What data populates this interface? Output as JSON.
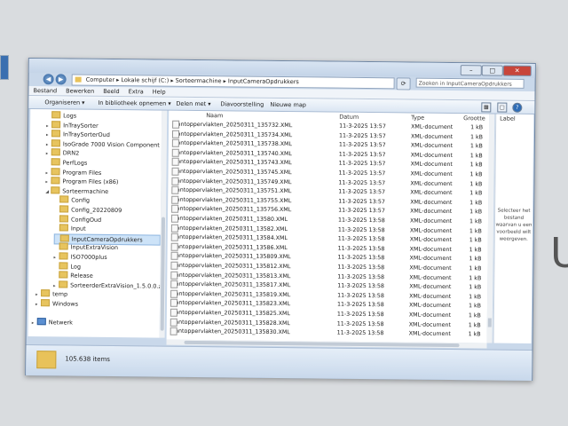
{
  "window": {
    "minimize": "–",
    "maximize": "□",
    "close": "✕"
  },
  "address": {
    "segments": [
      "Computer",
      "Lokale schijf (C:)",
      "Sorteermachine",
      "InputCameraOpdrukkers"
    ],
    "search_placeholder": "Zoeken in InputCameraOpdrukkers"
  },
  "menu": [
    "Bestand",
    "Bewerken",
    "Beeld",
    "Extra",
    "Help"
  ],
  "toolbar": {
    "organize": "Organiseren ▾",
    "library": "In bibliotheek opnemen ▾",
    "share": "Delen met ▾",
    "slideshow": "Diavoorstelling",
    "new_folder": "Nieuwe map"
  },
  "nav": [
    {
      "label": "Logs",
      "indent": 1,
      "arrow": ""
    },
    {
      "label": "InTraySorter",
      "indent": 1,
      "arrow": "▸"
    },
    {
      "label": "InTraySorterOud",
      "indent": 1,
      "arrow": "▸"
    },
    {
      "label": "IsoGrade 7000 Vision Component Initial",
      "indent": 1,
      "arrow": "▸"
    },
    {
      "label": "DRN2",
      "indent": 1,
      "arrow": "▸"
    },
    {
      "label": "PerfLogs",
      "indent": 1,
      "arrow": ""
    },
    {
      "label": "Program Files",
      "indent": 1,
      "arrow": "▸"
    },
    {
      "label": "Program Files (x86)",
      "indent": 1,
      "arrow": "▸"
    },
    {
      "label": "Sorteermachine",
      "indent": 1,
      "arrow": "◢"
    },
    {
      "label": "Config",
      "indent": 2,
      "arrow": ""
    },
    {
      "label": "Config_20220809",
      "indent": 2,
      "arrow": ""
    },
    {
      "label": "ConfigOud",
      "indent": 2,
      "arrow": ""
    },
    {
      "label": "Input",
      "indent": 2,
      "arrow": ""
    },
    {
      "label": "InputCameraOpdrukkers",
      "indent": 2,
      "arrow": "",
      "selected": true
    },
    {
      "label": "InputExtraVision",
      "indent": 2,
      "arrow": ""
    },
    {
      "label": "ISO7000plus",
      "indent": 2,
      "arrow": "▸"
    },
    {
      "label": "Log",
      "indent": 2,
      "arrow": ""
    },
    {
      "label": "Release",
      "indent": 2,
      "arrow": ""
    },
    {
      "label": "SorteerderExtraVision_1.5.0.0.zip",
      "indent": 2,
      "arrow": "▸"
    },
    {
      "label": "temp",
      "indent": 0,
      "arrow": "▸"
    },
    {
      "label": "Windows",
      "indent": 0,
      "arrow": "▸"
    },
    {
      "label": "",
      "indent": 0,
      "arrow": ""
    },
    {
      "label": "Netwerk",
      "indent": -1,
      "arrow": "▸"
    }
  ],
  "columns": {
    "name": "Naam",
    "date": "Datum",
    "type": "Type",
    "size": "Grootte",
    "label": "Label"
  },
  "files": [
    {
      "name": "Plantoppervlakten_20250311_135732.XML",
      "date": "11-3-2025 13:57",
      "type": "XML-document",
      "size": "1 kB"
    },
    {
      "name": "Plantoppervlakten_20250311_135734.XML",
      "date": "11-3-2025 13:57",
      "type": "XML-document",
      "size": "1 kB"
    },
    {
      "name": "Plantoppervlakten_20250311_135738.XML",
      "date": "11-3-2025 13:57",
      "type": "XML-document",
      "size": "1 kB"
    },
    {
      "name": "Plantoppervlakten_20250311_135740.XML",
      "date": "11-3-2025 13:57",
      "type": "XML-document",
      "size": "1 kB"
    },
    {
      "name": "Plantoppervlakten_20250311_135743.XML",
      "date": "11-3-2025 13:57",
      "type": "XML-document",
      "size": "1 kB"
    },
    {
      "name": "Plantoppervlakten_20250311_135745.XML",
      "date": "11-3-2025 13:57",
      "type": "XML-document",
      "size": "1 kB"
    },
    {
      "name": "Plantoppervlakten_20250311_135749.XML",
      "date": "11-3-2025 13:57",
      "type": "XML-document",
      "size": "1 kB"
    },
    {
      "name": "Plantoppervlakten_20250311_135751.XML",
      "date": "11-3-2025 13:57",
      "type": "XML-document",
      "size": "1 kB"
    },
    {
      "name": "Plantoppervlakten_20250311_135755.XML",
      "date": "11-3-2025 13:57",
      "type": "XML-document",
      "size": "1 kB"
    },
    {
      "name": "Plantoppervlakten_20250311_135756.XML",
      "date": "11-3-2025 13:57",
      "type": "XML-document",
      "size": "1 kB"
    },
    {
      "name": "Plantoppervlakten_20250311_13580.XML",
      "date": "11-3-2025 13:58",
      "type": "XML-document",
      "size": "1 kB"
    },
    {
      "name": "Plantoppervlakten_20250311_13582.XML",
      "date": "11-3-2025 13:58",
      "type": "XML-document",
      "size": "1 kB"
    },
    {
      "name": "Plantoppervlakten_20250311_13584.XML",
      "date": "11-3-2025 13:58",
      "type": "XML-document",
      "size": "1 kB"
    },
    {
      "name": "Plantoppervlakten_20250311_13586.XML",
      "date": "11-3-2025 13:58",
      "type": "XML-document",
      "size": "1 kB"
    },
    {
      "name": "Plantoppervlakten_20250311_135809.XML",
      "date": "11-3-2025 13:58",
      "type": "XML-document",
      "size": "1 kB"
    },
    {
      "name": "Plantoppervlakten_20250311_135812.XML",
      "date": "11-3-2025 13:58",
      "type": "XML-document",
      "size": "1 kB"
    },
    {
      "name": "Plantoppervlakten_20250311_135813.XML",
      "date": "11-3-2025 13:58",
      "type": "XML-document",
      "size": "1 kB"
    },
    {
      "name": "Plantoppervlakten_20250311_135817.XML",
      "date": "11-3-2025 13:58",
      "type": "XML-document",
      "size": "1 kB"
    },
    {
      "name": "Plantoppervlakten_20250311_135819.XML",
      "date": "11-3-2025 13:58",
      "type": "XML-document",
      "size": "1 kB"
    },
    {
      "name": "Plantoppervlakten_20250311_135823.XML",
      "date": "11-3-2025 13:58",
      "type": "XML-document",
      "size": "1 kB"
    },
    {
      "name": "Plantoppervlakten_20250311_135825.XML",
      "date": "11-3-2025 13:58",
      "type": "XML-document",
      "size": "1 kB"
    },
    {
      "name": "Plantoppervlakten_20250311_135828.XML",
      "date": "11-3-2025 13:58",
      "type": "XML-document",
      "size": "1 kB"
    },
    {
      "name": "Plantoppervlakten_20250311_135830.XML",
      "date": "11-3-2025 13:58",
      "type": "XML-document",
      "size": "1 kB"
    }
  ],
  "preview_text": "Selecteer het bestand waarvan u een voorbeeld wilt weergeven.",
  "status": {
    "count": "105.638 items"
  },
  "background": {
    "right_char": "U"
  }
}
